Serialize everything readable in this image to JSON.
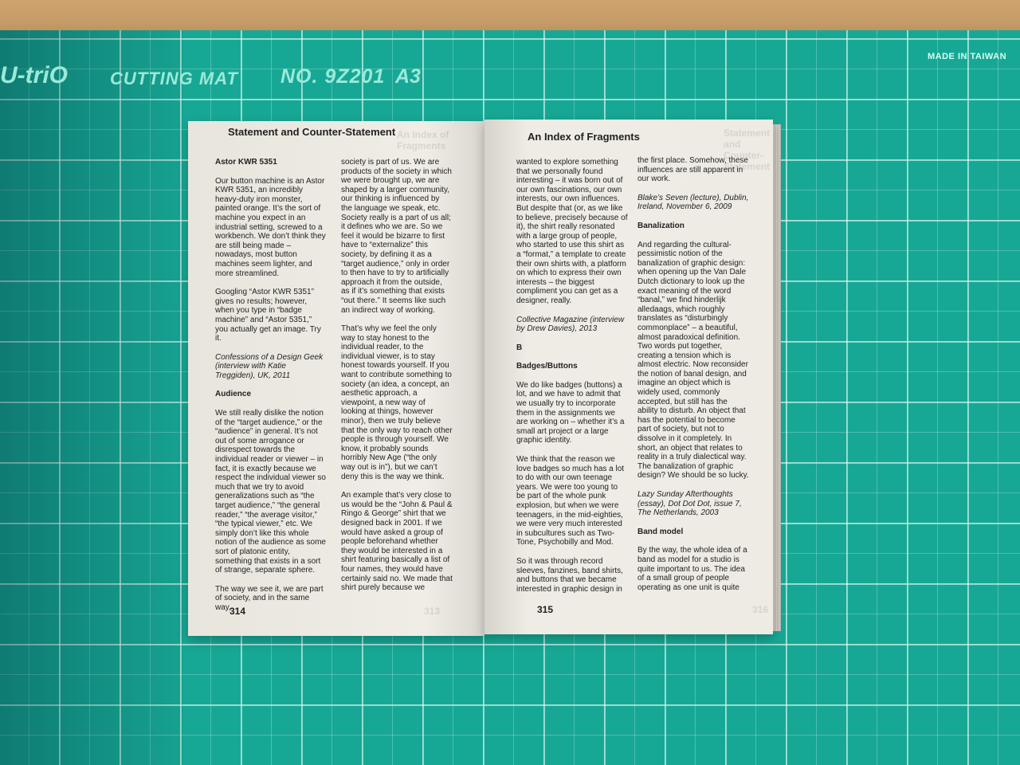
{
  "mat": {
    "brand": "U-triO",
    "product": "CUTTING MAT",
    "model": "NO. 9Z201",
    "size": "A3",
    "origin": "MADE IN TAIWAN"
  },
  "left_page": {
    "running_head": "Statement and Counter-Statement",
    "ghost_head": "An Index of Fragments",
    "folio": "314",
    "ghost_folio": "313",
    "col1": [
      {
        "type": "h",
        "text": "Astor KWR 5351"
      },
      {
        "type": "p",
        "text": "Our button machine is an Astor KWR 5351, an incredibly heavy-duty iron monster, painted orange. It’s the sort of machine you expect in an industrial setting, screwed to a workbench. We don’t think they are still being made – nowadays, most button machines seem lighter, and more streamlined."
      },
      {
        "type": "p",
        "text": "Googling “Astor KWR 5351” gives no results; however, when you type in “badge machine” and “Astor 5351,” you actually get an image. Try it."
      },
      {
        "type": "it",
        "text": "Confessions of a Design Geek (interview with Katie Treggiden), UK, 2011"
      },
      {
        "type": "h",
        "text": "Audience"
      },
      {
        "type": "p",
        "text": "We still really dislike the notion of the “target audience,” or the “audience” in general. It’s not out of some arrogance or disrespect towards the individual reader or viewer – in fact, it is exactly because we respect the individual viewer so much that we try to avoid generalizations such as “the target audience,” “the general reader,” “the average visitor,” “the typical viewer,” etc. We simply don’t like this whole notion of the audience as some sort of platonic entity, something that exists in a sort of strange, separate sphere."
      },
      {
        "type": "p",
        "text": "The way we see it, we are part of society, and in the same way,"
      }
    ],
    "col2": [
      {
        "type": "p",
        "text": "society is part of us. We are products of the society in which we were brought up, we are shaped by a larger community, our thinking is influenced by the language we speak, etc. Society really is a part of us all; it defines who we are. So we feel it would be bizarre to first have to “externalize” this society, by defining it as a “target audience,” only in order to then have to try to artificially approach it from the outside, as if it’s something that exists “out there.” It seems like such an indirect way of working."
      },
      {
        "type": "p",
        "text": "That’s why we feel the only way to stay honest to the individual reader, to the individual viewer, is to stay honest towards yourself. If you want to contribute something to society (an idea, a concept, an aesthetic approach, a viewpoint, a new way of looking at things, however minor), then we truly believe that the only way to reach other people is through yourself. We know, it probably sounds horribly New Age (“the only way out is in”), but we can’t deny this is the way we think."
      },
      {
        "type": "p",
        "text": "An example that’s very close to us would be the “John & Paul & Ringo & George” shirt that we designed back in 2001. If we would have asked a group of people beforehand whether they would be interested in a shirt featuring basically a list of four names, they would have certainly said no. We made that shirt purely because we"
      }
    ]
  },
  "right_page": {
    "running_head": "An Index of Fragments",
    "ghost_head": "Statement and Counter-Statement",
    "folio": "315",
    "ghost_folio": "316",
    "col1": [
      {
        "type": "p",
        "text": "wanted to explore something that we personally found interesting – it was born out of our own fascinations, our own interests, our own influences. But despite that (or, as we like to believe, precisely because of it), the shirt really resonated with a large group of people, who started to use this shirt as a “format,” a template to create their own shirts with, a platform on which to express their own interests – the biggest compliment you can get as a designer, really."
      },
      {
        "type": "it",
        "text": "Collective Magazine (interview by Drew Davies), 2013"
      },
      {
        "type": "h",
        "text": "B"
      },
      {
        "type": "h",
        "text": "Badges/Buttons"
      },
      {
        "type": "p",
        "text": "We do like badges (buttons) a lot, and we have to admit that we usually try to incorporate them in the assignments we are working on – whether it’s a small art project or a large graphic identity."
      },
      {
        "type": "p",
        "text": "We think that the reason we love badges so much has a lot to do with our own teenage years. We were too young to be part of the whole punk explosion, but when we were teenagers, in the mid-eighties, we were very much interested in subcultures such as Two-Tone, Psychobilly and Mod."
      },
      {
        "type": "p",
        "text": "So it was through record sleeves, fanzines, band shirts, and buttons that we became interested in graphic design in"
      }
    ],
    "col2": [
      {
        "type": "p",
        "text": "the first place. Somehow, these influences are still apparent in our work."
      },
      {
        "type": "it",
        "text": "Blake’s Seven (lecture), Dublin, Ireland, November 6, 2009"
      },
      {
        "type": "h",
        "text": "Banalization"
      },
      {
        "type": "p",
        "text": "And regarding the cultural-pessimistic notion of the banalization of graphic design: when opening up the Van Dale Dutch dictionary to look up the exact meaning of the word “banal,” we find hinderlijk alledaags, which roughly translates as “disturbingly commonplace” – a beautiful, almost paradoxical definition. Two words put together, creating a tension which is almost electric. Now reconsider the notion of banal design, and imagine an object which is widely used, commonly accepted, but still has the ability to disturb. An object that has the potential to become part of society, but not to dissolve in it completely. In short, an object that relates to reality in a truly dialectical way. The banalization of graphic design? We should be so lucky."
      },
      {
        "type": "it",
        "text": "Lazy Sunday Afterthoughts (essay), Dot Dot Dot, issue 7, The Netherlands, 2003"
      },
      {
        "type": "h",
        "text": "Band model"
      },
      {
        "type": "p",
        "text": "By the way, the whole idea of a band as model for a studio is quite important to us. The idea of a small group of people operating as one unit is quite"
      }
    ]
  }
}
